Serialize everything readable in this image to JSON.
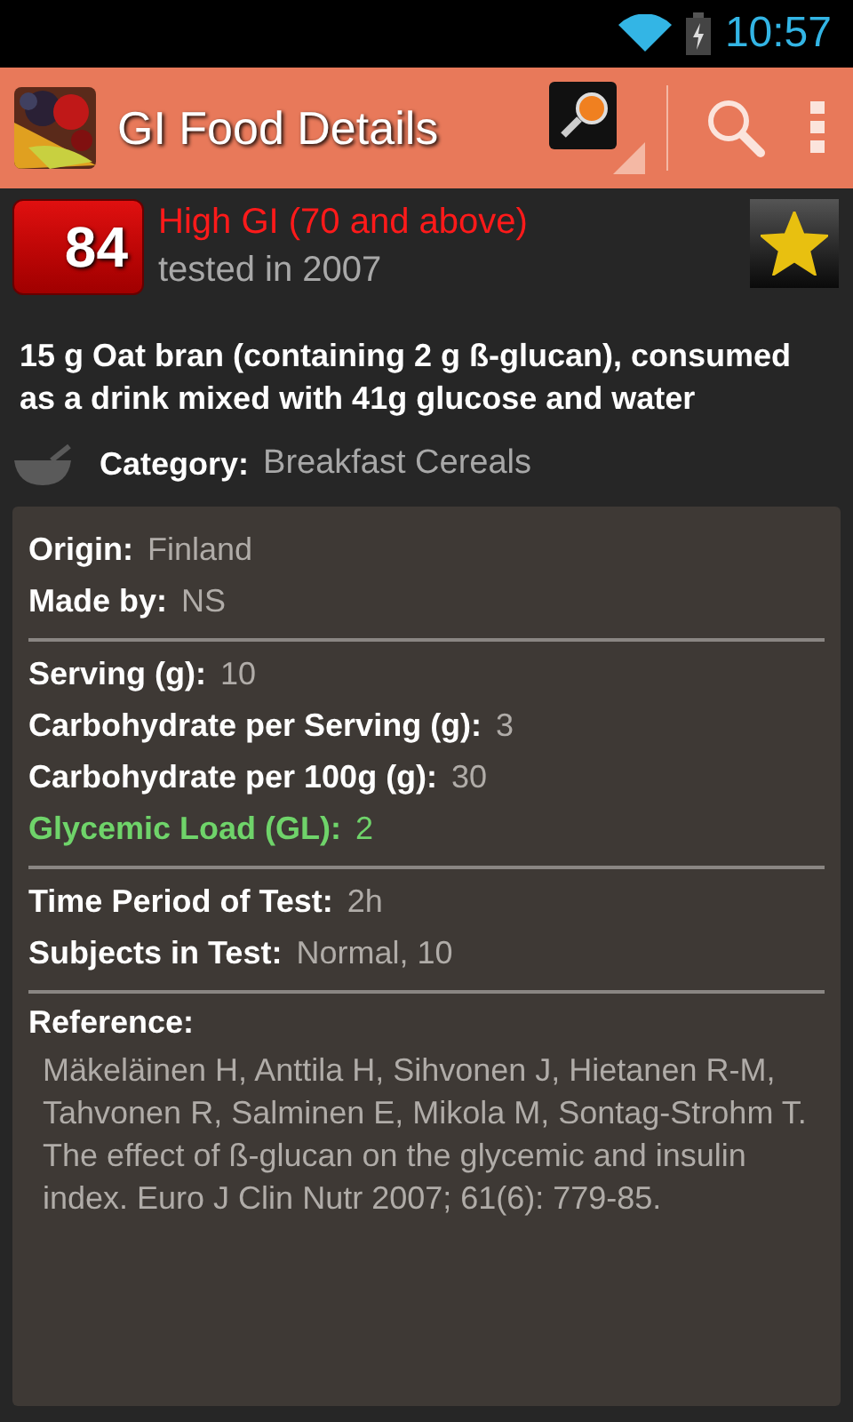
{
  "status_bar": {
    "time": "10:57"
  },
  "action_bar": {
    "title": "GI Food Details"
  },
  "gi": {
    "value": "84",
    "kind": "high",
    "label": "High GI (70 and above)",
    "tested": "tested in 2007",
    "favorite": true
  },
  "description": "15 g Oat bran (containing 2 g ß-glucan), consumed as a drink mixed with 41g glucose and water",
  "category": {
    "label": "Category:",
    "value": "Breakfast Cereals"
  },
  "sections": [
    {
      "rows": [
        {
          "kind": "normal",
          "label": "Origin:",
          "value": "Finland"
        },
        {
          "kind": "normal",
          "label": "Made by:",
          "value": "NS"
        }
      ]
    },
    {
      "rows": [
        {
          "kind": "normal",
          "label": "Serving (g):",
          "value": "10"
        },
        {
          "kind": "normal",
          "label": "Carbohydrate per Serving (g):",
          "value": "3"
        },
        {
          "kind": "normal",
          "label": "Carbohydrate per 100g (g):",
          "value": "30"
        },
        {
          "kind": "highlight",
          "label": "Glycemic Load (GL):",
          "value": "2"
        }
      ]
    },
    {
      "rows": [
        {
          "kind": "normal",
          "label": "Time Period of Test:",
          "value": "2h"
        },
        {
          "kind": "normal",
          "label": "Subjects in Test:",
          "value": "Normal, 10"
        }
      ]
    }
  ],
  "reference": {
    "label": "Reference:",
    "text": "Mäkeläinen H, Anttila H, Sihvonen J, Hietanen R-M, Tahvonen R, Salminen E, Mikola M, Sontag-Strohm T. The effect of ß-glucan on the glycemic and insulin index. Euro J Clin Nutr 2007; 61(6): 779-85."
  }
}
